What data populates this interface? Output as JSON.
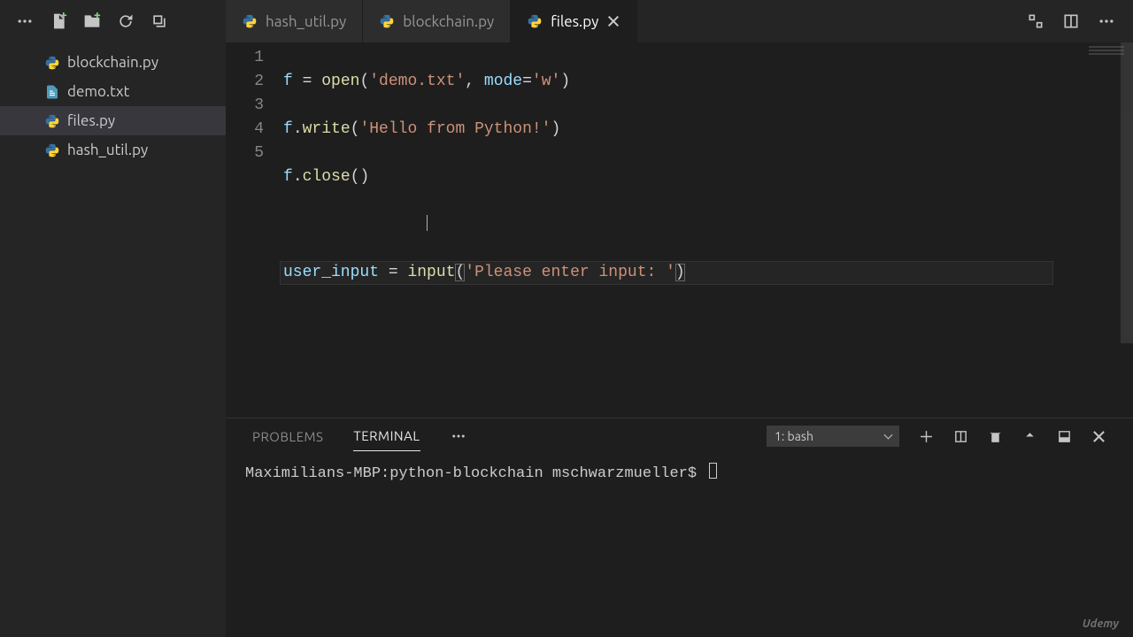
{
  "sidebar": {
    "files": [
      {
        "name": "blockchain.py",
        "type": "py",
        "active": false
      },
      {
        "name": "demo.txt",
        "type": "txt",
        "active": false
      },
      {
        "name": "files.py",
        "type": "py",
        "active": true
      },
      {
        "name": "hash_util.py",
        "type": "py",
        "active": false
      }
    ]
  },
  "tabs": [
    {
      "label": "hash_util.py",
      "active": false,
      "closeable": false
    },
    {
      "label": "blockchain.py",
      "active": false,
      "closeable": false
    },
    {
      "label": "files.py",
      "active": true,
      "closeable": true
    }
  ],
  "editor": {
    "line_numbers": [
      "1",
      "2",
      "3",
      "4",
      "5"
    ],
    "lines": {
      "l1_var": "f",
      "l1_assign": " = ",
      "l1_fn": "open",
      "l1_p1": "(",
      "l1_str1": "'demo.txt'",
      "l1_comma": ", ",
      "l1_param": "mode",
      "l1_eq": "=",
      "l1_str2": "'w'",
      "l1_p2": ")",
      "l2_var": "f",
      "l2_dot": ".",
      "l2_fn": "write",
      "l2_p1": "(",
      "l2_str": "'Hello from Python!'",
      "l2_p2": ")",
      "l3_var": "f",
      "l3_dot": ".",
      "l3_fn": "close",
      "l3_p1": "(",
      "l3_p2": ")",
      "l5_var": "user_input",
      "l5_assign": " = ",
      "l5_fn": "input",
      "l5_p1": "(",
      "l5_str": "'Please enter input: '",
      "l5_p2": ")"
    }
  },
  "panel": {
    "tabs": {
      "problems": "Problems",
      "terminal": "Terminal"
    },
    "terminal_selector": "1: bash",
    "prompt": "Maximilians-MBP:python-blockchain mschwarzmueller$ "
  },
  "footer": {
    "brand": "Udemy"
  }
}
